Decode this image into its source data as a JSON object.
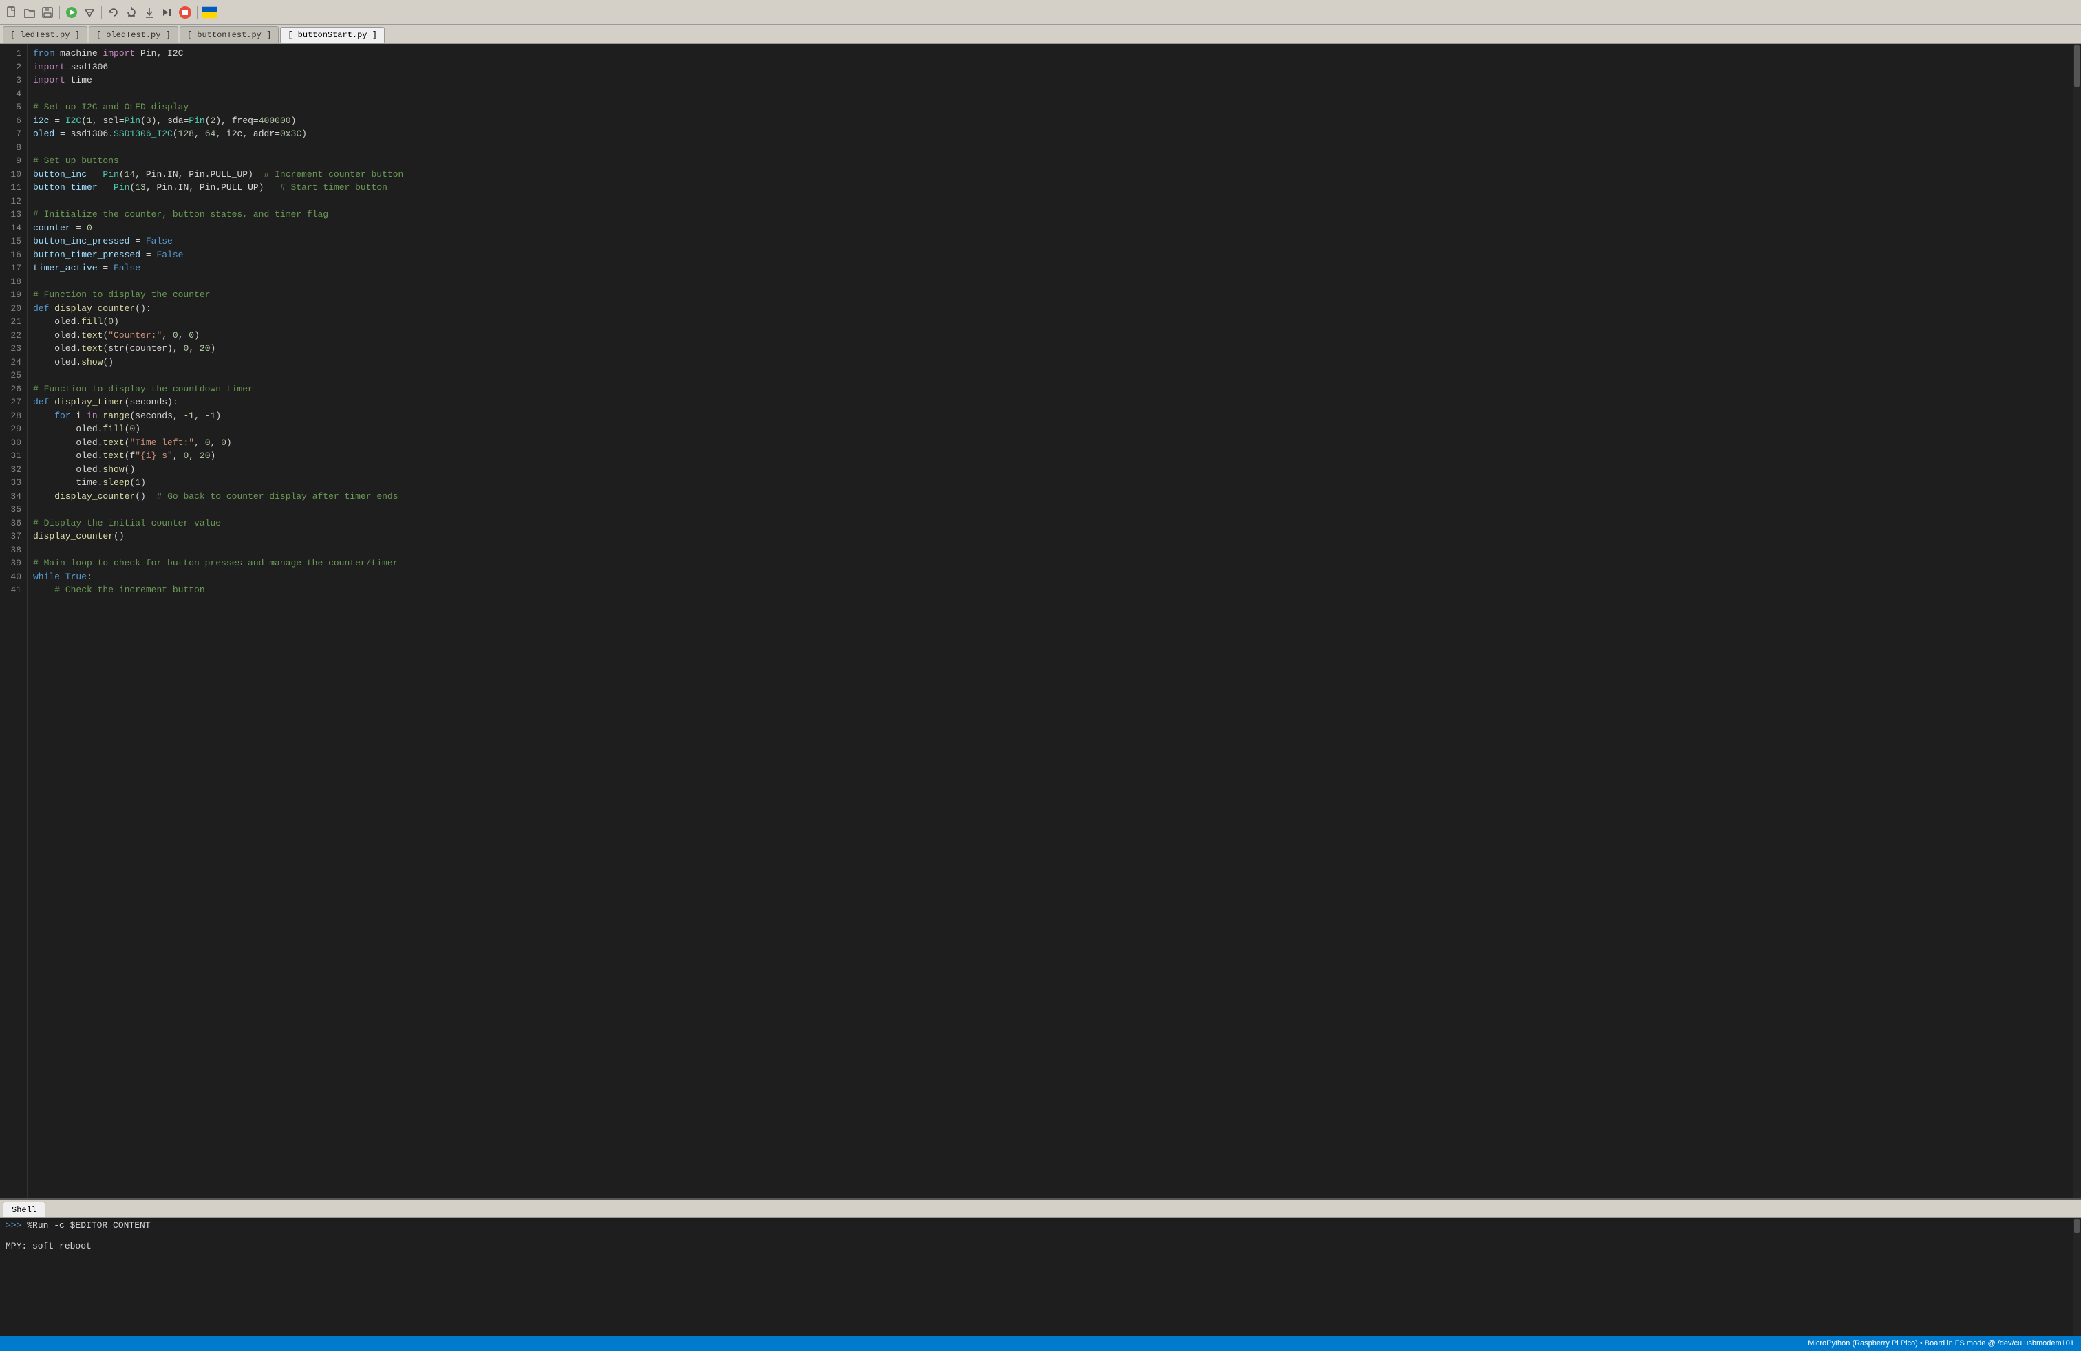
{
  "toolbar": {
    "icons": [
      {
        "name": "new-file-icon",
        "glyph": "📄"
      },
      {
        "name": "open-file-icon",
        "glyph": "📂"
      },
      {
        "name": "save-file-icon",
        "glyph": "💾"
      },
      {
        "name": "run-icon",
        "glyph": "▶"
      },
      {
        "name": "debug-icon",
        "glyph": "🔧"
      },
      {
        "name": "undo-icon",
        "glyph": "↩"
      },
      {
        "name": "step-over-icon",
        "glyph": "↷"
      },
      {
        "name": "step-into-icon",
        "glyph": "↘"
      },
      {
        "name": "resume-icon",
        "glyph": "▶▶"
      },
      {
        "name": "stop-icon",
        "glyph": "⏹"
      },
      {
        "name": "flag-icon",
        "glyph": "🟨"
      }
    ]
  },
  "tabs": [
    {
      "label": "[ ledTest.py ]",
      "active": false
    },
    {
      "label": "[ oledTest.py ]",
      "active": false
    },
    {
      "label": "[ buttonTest.py ]",
      "active": false
    },
    {
      "label": "[ buttonStart.py ]",
      "active": true
    }
  ],
  "code_lines": [
    {
      "num": 1,
      "tokens": [
        {
          "t": "kw",
          "v": "from"
        },
        {
          "t": "op",
          "v": " machine "
        },
        {
          "t": "kw2",
          "v": "import"
        },
        {
          "t": "op",
          "v": " Pin, I2C"
        }
      ]
    },
    {
      "num": 2,
      "tokens": [
        {
          "t": "kw2",
          "v": "import"
        },
        {
          "t": "op",
          "v": " ssd1306"
        }
      ]
    },
    {
      "num": 3,
      "tokens": [
        {
          "t": "kw2",
          "v": "import"
        },
        {
          "t": "op",
          "v": " time"
        }
      ]
    },
    {
      "num": 4,
      "tokens": []
    },
    {
      "num": 5,
      "tokens": [
        {
          "t": "cmt",
          "v": "# Set up I2C and OLED display"
        }
      ]
    },
    {
      "num": 6,
      "tokens": [
        {
          "t": "param",
          "v": "i2c"
        },
        {
          "t": "op",
          "v": " = "
        },
        {
          "t": "cls",
          "v": "I2C"
        },
        {
          "t": "op",
          "v": "("
        },
        {
          "t": "num",
          "v": "1"
        },
        {
          "t": "op",
          "v": ", scl="
        },
        {
          "t": "cls",
          "v": "Pin"
        },
        {
          "t": "op",
          "v": "("
        },
        {
          "t": "num",
          "v": "3"
        },
        {
          "t": "op",
          "v": "), sda="
        },
        {
          "t": "cls",
          "v": "Pin"
        },
        {
          "t": "op",
          "v": "("
        },
        {
          "t": "num",
          "v": "2"
        },
        {
          "t": "op",
          "v": "), freq="
        },
        {
          "t": "num",
          "v": "400000"
        },
        {
          "t": "op",
          "v": ")"
        }
      ]
    },
    {
      "num": 7,
      "tokens": [
        {
          "t": "param",
          "v": "oled"
        },
        {
          "t": "op",
          "v": " = ssd1306."
        },
        {
          "t": "cls",
          "v": "SSD1306_I2C"
        },
        {
          "t": "op",
          "v": "("
        },
        {
          "t": "num",
          "v": "128"
        },
        {
          "t": "op",
          "v": ", "
        },
        {
          "t": "num",
          "v": "64"
        },
        {
          "t": "op",
          "v": ", i2c, addr="
        },
        {
          "t": "num",
          "v": "0x3C"
        },
        {
          "t": "op",
          "v": ")"
        }
      ]
    },
    {
      "num": 8,
      "tokens": []
    },
    {
      "num": 9,
      "tokens": [
        {
          "t": "cmt",
          "v": "# Set up buttons"
        }
      ]
    },
    {
      "num": 10,
      "tokens": [
        {
          "t": "param",
          "v": "button_inc"
        },
        {
          "t": "op",
          "v": " = "
        },
        {
          "t": "cls",
          "v": "Pin"
        },
        {
          "t": "op",
          "v": "("
        },
        {
          "t": "num",
          "v": "14"
        },
        {
          "t": "op",
          "v": ", Pin.IN, Pin.PULL_UP)  "
        },
        {
          "t": "cmt",
          "v": "# Increment counter button"
        }
      ]
    },
    {
      "num": 11,
      "tokens": [
        {
          "t": "param",
          "v": "button_timer"
        },
        {
          "t": "op",
          "v": " = "
        },
        {
          "t": "cls",
          "v": "Pin"
        },
        {
          "t": "op",
          "v": "("
        },
        {
          "t": "num",
          "v": "13"
        },
        {
          "t": "op",
          "v": ", Pin.IN, Pin.PULL_UP)   "
        },
        {
          "t": "cmt",
          "v": "# Start timer button"
        }
      ]
    },
    {
      "num": 12,
      "tokens": []
    },
    {
      "num": 13,
      "tokens": [
        {
          "t": "cmt",
          "v": "# Initialize the counter, button states, and timer flag"
        }
      ]
    },
    {
      "num": 14,
      "tokens": [
        {
          "t": "param",
          "v": "counter"
        },
        {
          "t": "op",
          "v": " = "
        },
        {
          "t": "num",
          "v": "0"
        }
      ]
    },
    {
      "num": 15,
      "tokens": [
        {
          "t": "param",
          "v": "button_inc_pressed"
        },
        {
          "t": "op",
          "v": " = "
        },
        {
          "t": "kw",
          "v": "False"
        }
      ]
    },
    {
      "num": 16,
      "tokens": [
        {
          "t": "param",
          "v": "button_timer_pressed"
        },
        {
          "t": "op",
          "v": " = "
        },
        {
          "t": "kw",
          "v": "False"
        }
      ]
    },
    {
      "num": 17,
      "tokens": [
        {
          "t": "param",
          "v": "timer_active"
        },
        {
          "t": "op",
          "v": " = "
        },
        {
          "t": "kw",
          "v": "False"
        }
      ]
    },
    {
      "num": 18,
      "tokens": []
    },
    {
      "num": 19,
      "tokens": [
        {
          "t": "cmt",
          "v": "# Function to display the counter"
        }
      ]
    },
    {
      "num": 20,
      "tokens": [
        {
          "t": "kw",
          "v": "def "
        },
        {
          "t": "fn",
          "v": "display_counter"
        },
        {
          "t": "op",
          "v": "():"
        }
      ]
    },
    {
      "num": 21,
      "tokens": [
        {
          "t": "op",
          "v": "    oled."
        },
        {
          "t": "fn",
          "v": "fill"
        },
        {
          "t": "op",
          "v": "("
        },
        {
          "t": "num",
          "v": "0"
        },
        {
          "t": "op",
          "v": ")"
        }
      ]
    },
    {
      "num": 22,
      "tokens": [
        {
          "t": "op",
          "v": "    oled."
        },
        {
          "t": "fn",
          "v": "text"
        },
        {
          "t": "op",
          "v": "("
        },
        {
          "t": "str",
          "v": "\"Counter:\""
        },
        {
          "t": "op",
          "v": ", "
        },
        {
          "t": "num",
          "v": "0"
        },
        {
          "t": "op",
          "v": ", "
        },
        {
          "t": "num",
          "v": "0"
        },
        {
          "t": "op",
          "v": ")"
        }
      ]
    },
    {
      "num": 23,
      "tokens": [
        {
          "t": "op",
          "v": "    oled."
        },
        {
          "t": "fn",
          "v": "text"
        },
        {
          "t": "op",
          "v": "(str(counter), "
        },
        {
          "t": "num",
          "v": "0"
        },
        {
          "t": "op",
          "v": ", "
        },
        {
          "t": "num",
          "v": "20"
        },
        {
          "t": "op",
          "v": ")"
        }
      ]
    },
    {
      "num": 24,
      "tokens": [
        {
          "t": "op",
          "v": "    oled."
        },
        {
          "t": "fn",
          "v": "show"
        },
        {
          "t": "op",
          "v": "()"
        }
      ]
    },
    {
      "num": 25,
      "tokens": []
    },
    {
      "num": 26,
      "tokens": [
        {
          "t": "cmt",
          "v": "# Function to display the countdown timer"
        }
      ]
    },
    {
      "num": 27,
      "tokens": [
        {
          "t": "kw",
          "v": "def "
        },
        {
          "t": "fn",
          "v": "display_timer"
        },
        {
          "t": "op",
          "v": "(seconds):"
        }
      ]
    },
    {
      "num": 28,
      "tokens": [
        {
          "t": "op",
          "v": "    "
        },
        {
          "t": "kw",
          "v": "for"
        },
        {
          "t": "op",
          "v": " i "
        },
        {
          "t": "kw2",
          "v": "in"
        },
        {
          "t": "op",
          "v": " "
        },
        {
          "t": "fn",
          "v": "range"
        },
        {
          "t": "op",
          "v": "(seconds, "
        },
        {
          "t": "num",
          "v": "-1"
        },
        {
          "t": "op",
          "v": ", "
        },
        {
          "t": "num",
          "v": "-1"
        },
        {
          "t": "op",
          "v": ")"
        }
      ]
    },
    {
      "num": 29,
      "tokens": [
        {
          "t": "op",
          "v": "        oled."
        },
        {
          "t": "fn",
          "v": "fill"
        },
        {
          "t": "op",
          "v": "("
        },
        {
          "t": "num",
          "v": "0"
        },
        {
          "t": "op",
          "v": ")"
        }
      ]
    },
    {
      "num": 30,
      "tokens": [
        {
          "t": "op",
          "v": "        oled."
        },
        {
          "t": "fn",
          "v": "text"
        },
        {
          "t": "op",
          "v": "("
        },
        {
          "t": "str",
          "v": "\"Time left:\""
        },
        {
          "t": "op",
          "v": ", "
        },
        {
          "t": "num",
          "v": "0"
        },
        {
          "t": "op",
          "v": ", "
        },
        {
          "t": "num",
          "v": "0"
        },
        {
          "t": "op",
          "v": ")"
        }
      ]
    },
    {
      "num": 31,
      "tokens": [
        {
          "t": "op",
          "v": "        oled."
        },
        {
          "t": "fn",
          "v": "text"
        },
        {
          "t": "op",
          "v": "(f"
        },
        {
          "t": "str",
          "v": "\"{i} s\""
        },
        {
          "t": "op",
          "v": ", "
        },
        {
          "t": "num",
          "v": "0"
        },
        {
          "t": "op",
          "v": ", "
        },
        {
          "t": "num",
          "v": "20"
        },
        {
          "t": "op",
          "v": ")"
        }
      ]
    },
    {
      "num": 32,
      "tokens": [
        {
          "t": "op",
          "v": "        oled."
        },
        {
          "t": "fn",
          "v": "show"
        },
        {
          "t": "op",
          "v": "()"
        }
      ]
    },
    {
      "num": 33,
      "tokens": [
        {
          "t": "op",
          "v": "        time."
        },
        {
          "t": "fn",
          "v": "sleep"
        },
        {
          "t": "op",
          "v": "("
        },
        {
          "t": "num",
          "v": "1"
        },
        {
          "t": "op",
          "v": ")"
        }
      ]
    },
    {
      "num": 34,
      "tokens": [
        {
          "t": "op",
          "v": "    "
        },
        {
          "t": "fn",
          "v": "display_counter"
        },
        {
          "t": "op",
          "v": "()  "
        },
        {
          "t": "cmt",
          "v": "# Go back to counter display after timer ends"
        }
      ]
    },
    {
      "num": 35,
      "tokens": []
    },
    {
      "num": 36,
      "tokens": [
        {
          "t": "cmt",
          "v": "# Display the initial counter value"
        }
      ]
    },
    {
      "num": 37,
      "tokens": [
        {
          "t": "fn",
          "v": "display_counter"
        },
        {
          "t": "op",
          "v": "()"
        }
      ]
    },
    {
      "num": 38,
      "tokens": []
    },
    {
      "num": 39,
      "tokens": [
        {
          "t": "cmt",
          "v": "# Main loop to check for button presses and manage the counter/timer"
        }
      ]
    },
    {
      "num": 40,
      "tokens": [
        {
          "t": "kw",
          "v": "while "
        },
        {
          "t": "kw",
          "v": "True"
        },
        {
          "t": "op",
          "v": ":"
        }
      ]
    },
    {
      "num": 41,
      "tokens": [
        {
          "t": "op",
          "v": "    "
        },
        {
          "t": "cmt",
          "v": "# Check the increment button"
        }
      ]
    }
  ],
  "shell": {
    "tab_label": "Shell",
    "prompt": ">>> ",
    "command": "%Run -c $EDITOR_CONTENT",
    "output_line1": "",
    "output_line2": "MPY: soft reboot"
  },
  "status_bar": {
    "text": "MicroPython (Raspberry Pi Pico)  •  Board in FS mode @ /dev/cu.usbmodem101"
  }
}
